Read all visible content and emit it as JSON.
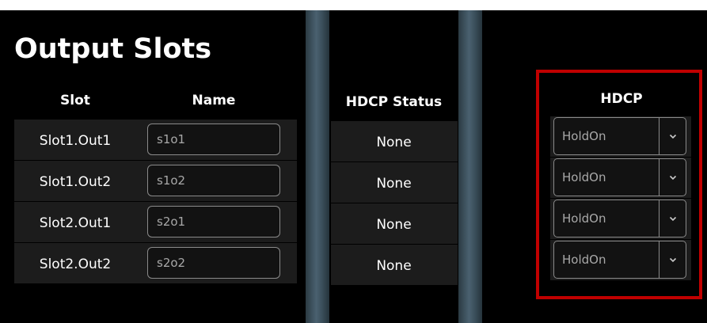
{
  "page": {
    "title": "Output Slots"
  },
  "table": {
    "headers": {
      "slot": "Slot",
      "name": "Name",
      "hdcp_status": "HDCP Status",
      "hdcp": "HDCP"
    },
    "rows": [
      {
        "slot": "Slot1.Out1",
        "name": "s1o1",
        "hdcp_status": "None",
        "hdcp": "HoldOn"
      },
      {
        "slot": "Slot1.Out2",
        "name": "s1o2",
        "hdcp_status": "None",
        "hdcp": "HoldOn"
      },
      {
        "slot": "Slot2.Out1",
        "name": "s2o1",
        "hdcp_status": "None",
        "hdcp": "HoldOn"
      },
      {
        "slot": "Slot2.Out2",
        "name": "s2o2",
        "hdcp_status": "None",
        "hdcp": "HoldOn"
      }
    ]
  },
  "colors": {
    "background": "#000000",
    "row_band": "#1c1c1c",
    "input_border": "#8a8a8a",
    "input_text": "#a8a8a8",
    "highlight": "#c00000"
  },
  "icons": {
    "dropdown": "chevron-down-icon"
  }
}
